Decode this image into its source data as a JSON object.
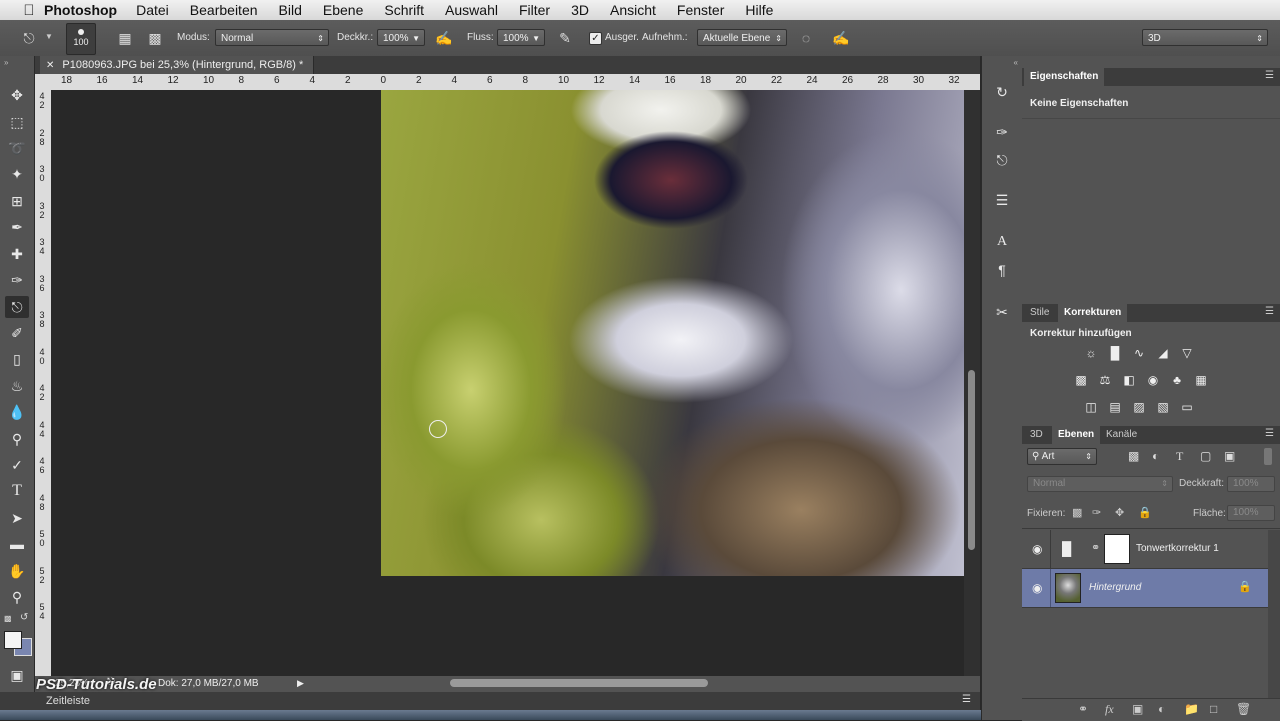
{
  "menubar": {
    "apple": "",
    "app": "Photoshop",
    "items": [
      "Datei",
      "Bearbeiten",
      "Bild",
      "Ebene",
      "Schrift",
      "Auswahl",
      "Filter",
      "3D",
      "Ansicht",
      "Fenster",
      "Hilfe"
    ]
  },
  "options": {
    "brush_size": "100",
    "modus_label": "Modus:",
    "modus_value": "Normal",
    "deckkr_label": "Deckkr.:",
    "deckkr_value": "100%",
    "fluss_label": "Fluss:",
    "fluss_value": "100%",
    "ausger_label": "Ausger.",
    "aufnehm_label": "Aufnehm.:",
    "aufnehm_value": "Aktuelle Ebene",
    "workspace": "3D"
  },
  "document": {
    "tab_title": "P1080963.JPG bei 25,3% (Hintergrund, RGB/8) *",
    "ruler_h": [
      "18",
      "16",
      "14",
      "12",
      "10",
      "8",
      "6",
      "4",
      "2",
      "0",
      "2",
      "4",
      "6",
      "8",
      "10",
      "12",
      "14",
      "16",
      "18",
      "20",
      "22",
      "24",
      "26",
      "28",
      "30",
      "32"
    ],
    "ruler_v": [
      "4",
      "2",
      "2",
      "8",
      "3",
      "0",
      "3",
      "2",
      "3",
      "4",
      "3",
      "6",
      "3",
      "8",
      "4",
      "0",
      "4",
      "2",
      "4",
      "4",
      "4",
      "6",
      "4",
      "8",
      "5",
      "0",
      "5",
      "2",
      "5",
      "4"
    ]
  },
  "status": {
    "zoom": "25,28%",
    "doc": "Dok: 27,0 MB/27,0 MB"
  },
  "timeline": {
    "label": "Zeitleiste"
  },
  "watermark": "PSD-Tutorials.de",
  "properties": {
    "tab": "Eigenschaften",
    "content": "Keine Eigenschaften"
  },
  "adjustments": {
    "tabs": [
      "Stile",
      "Korrekturen"
    ],
    "title": "Korrektur hinzufügen"
  },
  "layers_panel": {
    "tabs": [
      "3D",
      "Ebenen",
      "Kanäle"
    ],
    "filter": "Art",
    "blend": "Normal",
    "opacity_label": "Deckkraft:",
    "opacity_value": "100%",
    "lock_label": "Fixieren:",
    "fill_label": "Fläche:",
    "fill_value": "100%",
    "layers": [
      {
        "name": "Tonwertkorrektur 1",
        "selected": false
      },
      {
        "name": "Hintergrund",
        "selected": true
      }
    ]
  },
  "colors": {
    "accent_selected_layer": "#6e7ba8",
    "panel_bg": "#535353",
    "canvas_bg": "#282828"
  },
  "icons": {
    "toolbar": [
      "move-icon",
      "marquee-icon",
      "lasso-icon",
      "magic-wand-icon",
      "crop-icon",
      "eyedropper-icon",
      "healing-icon",
      "brush-icon",
      "clone-stamp-icon",
      "history-brush-icon",
      "eraser-icon",
      "paint-bucket-icon",
      "blur-icon",
      "dodge-icon",
      "pen-icon",
      "type-icon",
      "path-select-icon",
      "rectangle-icon",
      "hand-icon",
      "zoom-icon"
    ]
  }
}
